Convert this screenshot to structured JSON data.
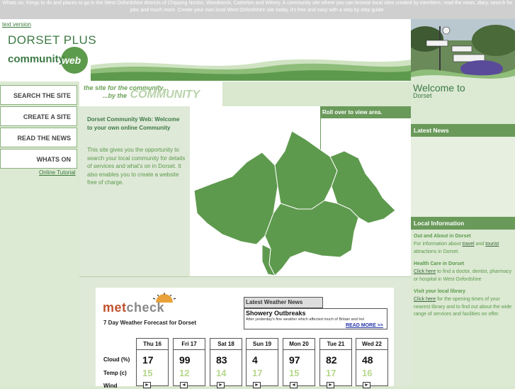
{
  "topbar": {
    "text": "Whats on, things to do and places to go in the West Oxfordshire districts of Chipping Norton, Woodstock, Carterton and Witney. A community site where you can browse local sites created by members, read the news, diary, search for jobs and much more. Create your own local West Oxfordshire site today, it's free and easy with a step by step guide."
  },
  "header": {
    "text_version": "text version",
    "brand_line1": "DORSET PLUS",
    "brand_line2": "community",
    "brand_line3": "web"
  },
  "nav": {
    "items": [
      {
        "label": "SEARCH THE SITE"
      },
      {
        "label": "CREATE A SITE"
      },
      {
        "label": "READ THE NEWS"
      },
      {
        "label": "WHATS ON"
      }
    ],
    "tutorial": "Online Tutorial"
  },
  "tagline": {
    "line1": "the site for the community...",
    "line2_small": "...by the",
    "line2_big": "COMMUNITY"
  },
  "welcome": {
    "title": "Dorset Community Web: Welcome to your own online Community",
    "body": "This site gives you the opportunity to search your local community for details of services and what's on in Dorset. It also enables you to create a website free of charge."
  },
  "map": {
    "rollover": "Roll over to view area."
  },
  "weather": {
    "logo_a": "met",
    "logo_b": "check",
    "subtitle": "7 Day Weather Forecast for Dorset",
    "news_head": "Latest Weather News",
    "news_title": "Showery Outbreaks",
    "news_text": "After yesterday's fine weather which affected much of Britain and Irel",
    "news_more": "READ MORE >>",
    "row_cloud": "Cloud (%)",
    "row_temp": "Temp (c)",
    "row_wind": "Wind",
    "days": [
      {
        "name": "Thu 16",
        "cloud": "17",
        "temp": "15"
      },
      {
        "name": "Fri 17",
        "cloud": "99",
        "temp": "12"
      },
      {
        "name": "Sat 18",
        "cloud": "83",
        "temp": "14"
      },
      {
        "name": "Sun 19",
        "cloud": "4",
        "temp": "17"
      },
      {
        "name": "Mon 20",
        "cloud": "97",
        "temp": "15"
      },
      {
        "name": "Tue 21",
        "cloud": "82",
        "temp": "17"
      },
      {
        "name": "Wed 22",
        "cloud": "48",
        "temp": "16"
      }
    ]
  },
  "right": {
    "welcome_to": "Welcome to",
    "welcome_dorset": "Dorset",
    "latest_news": "Latest News",
    "local_info": "Local Information",
    "s1_head": "Out and About in Dorset",
    "s1_pre": "For information about ",
    "s1_link1": "travel",
    "s1_mid": " and ",
    "s1_link2": "tourist",
    "s1_post": " attractions in Dorset.",
    "s2_head": "Health Care in Dorset",
    "s2_link": "Click here",
    "s2_post": " to find a doctor, dentist, pharmacy or hospital in West Oxfordshire",
    "s3_head": "Visit your local library",
    "s3_link": "Click here",
    "s3_post": " for the opening times of your nearest library and to find out about the wide range of services and facilities on offer."
  }
}
